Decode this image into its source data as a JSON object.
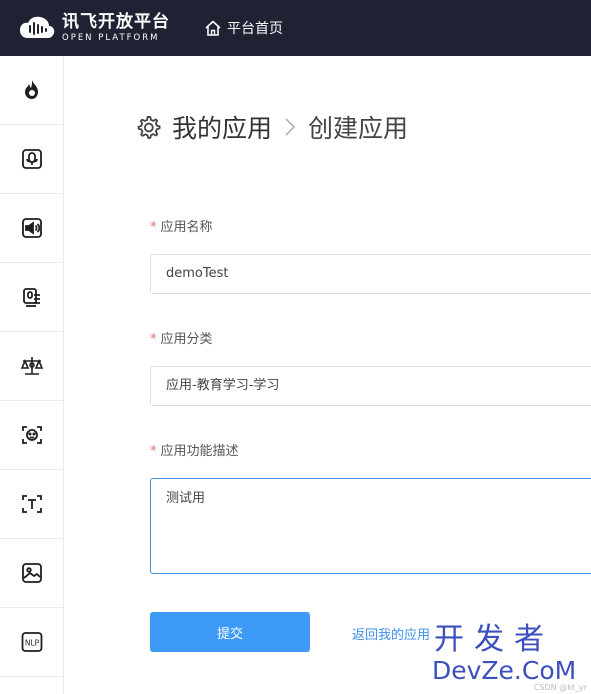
{
  "header": {
    "logo_cn": "讯飞开放平台",
    "logo_en": "OPEN PLATFORM",
    "home_label": "平台首页"
  },
  "sidebar": {
    "items": [
      {
        "icon": "flame-icon"
      },
      {
        "icon": "speech-recognition-icon"
      },
      {
        "icon": "speech-synthesis-icon"
      },
      {
        "icon": "voice-doc-icon"
      },
      {
        "icon": "balance-scale-icon"
      },
      {
        "icon": "face-recognition-icon"
      },
      {
        "icon": "text-recognition-icon"
      },
      {
        "icon": "image-icon"
      },
      {
        "icon": "nlp-icon",
        "label": "NLP"
      }
    ]
  },
  "breadcrumb": {
    "parent": "我的应用",
    "current": "创建应用"
  },
  "form": {
    "required_mark": "*",
    "app_name": {
      "label": "应用名称",
      "value": "demoTest"
    },
    "app_category": {
      "label": "应用分类",
      "value": "应用-教育学习-学习"
    },
    "app_description": {
      "label": "应用功能描述",
      "value": "测试用"
    },
    "submit_label": "提交",
    "back_label": "返回我的应用"
  },
  "watermark": {
    "cn": "开发者",
    "en": "DevZe.CoM",
    "small": "CSDN @kt_yr"
  },
  "colors": {
    "topbar": "#1e2233",
    "primary": "#3d9bf7",
    "link": "#3d8ff0",
    "required": "#f56c6c",
    "watermark": "#3b4fbf"
  }
}
